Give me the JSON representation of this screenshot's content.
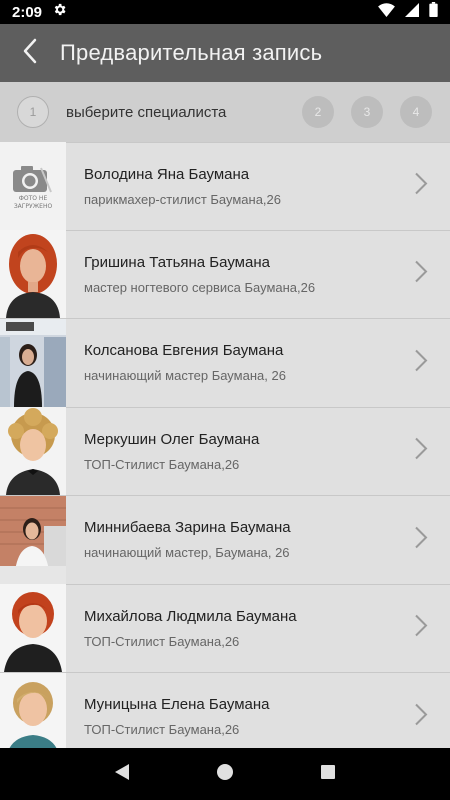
{
  "status": {
    "time": "2:09"
  },
  "header": {
    "title": "Предварительная запись"
  },
  "steps": {
    "current": "1",
    "current_label": "выберите специалиста",
    "others": [
      "2",
      "3",
      "4"
    ]
  },
  "placeholder": {
    "line1": "ФОТО НЕ",
    "line2": "ЗАГРУЖЕНО"
  },
  "specialists": [
    {
      "name": "Володина Яна Баумана",
      "subtitle": "парикмахер-стилист Баумана,26"
    },
    {
      "name": "Гришина Татьяна Баумана",
      "subtitle": "мастер ногтевого сервиса Баумана,26"
    },
    {
      "name": "Колсанова Евгения Баумана",
      "subtitle": "начинающий мастер Баумана, 26"
    },
    {
      "name": "Меркушин Олег Баумана",
      "subtitle": "ТОП-Стилист Баумана,26"
    },
    {
      "name": "Миннибаева Зарина Баумана",
      "subtitle": "начинающий мастер, Баумана, 26"
    },
    {
      "name": "Михайлова Людмила Баумана",
      "subtitle": "ТОП-Стилист Баумана,26"
    },
    {
      "name": "Муницына Елена Баумана",
      "subtitle": "ТОП-Стилист Баумана,26"
    }
  ],
  "colors": {
    "app_bar": "#5e5e5e",
    "steps_bar": "#cfcfcf",
    "list_bg": "#e0e0e0",
    "status_bar": "#000000"
  }
}
